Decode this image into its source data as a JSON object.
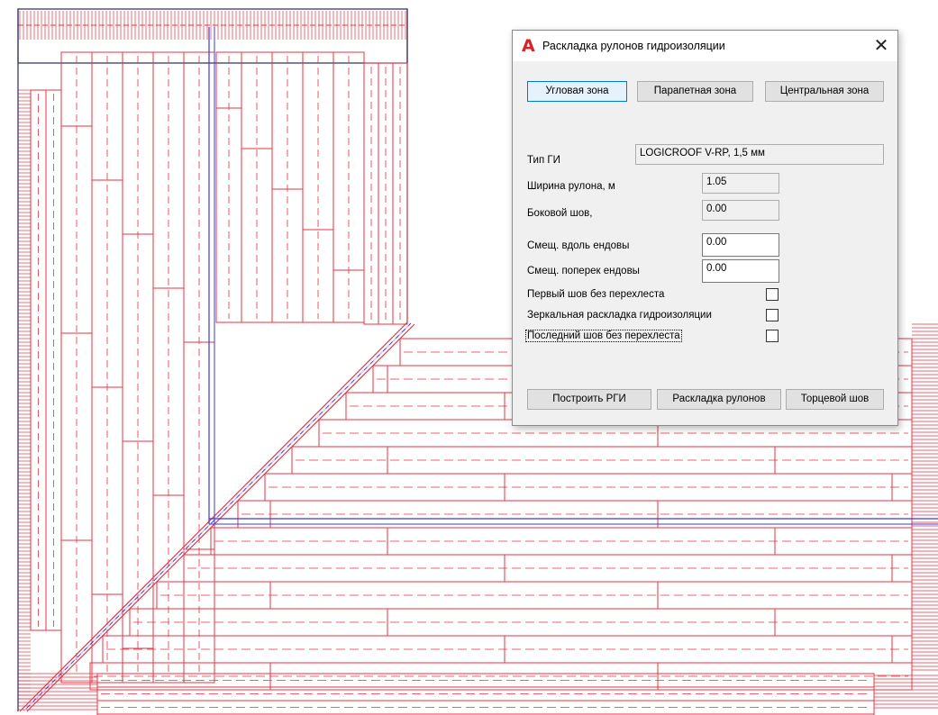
{
  "dialog": {
    "title": "Раскладка рулонов гидроизоляции",
    "app_icon_glyph": "A",
    "close_glyph": "✕",
    "zone_tabs": [
      {
        "label": "Угловая зона",
        "active": true
      },
      {
        "label": "Парапетная зона",
        "active": false
      },
      {
        "label": "Центральная зона",
        "active": false
      }
    ],
    "fields": {
      "type_label": "Тип ГИ",
      "type_value": "LOGICROOF V-RP, 1,5 мм",
      "roll_width_label": "Ширина рулона, м",
      "roll_width_value": "1.05",
      "side_seam_label": "Боковой шов,",
      "side_seam_value": "0.00",
      "offset_along_label": "Смещ. вдоль ендовы",
      "offset_along_value": "0.00",
      "offset_across_label": "Смещ. поперек ендовы",
      "offset_across_value": "0.00"
    },
    "checkboxes": [
      {
        "label": "Первый шов без перехлеста",
        "checked": false
      },
      {
        "label": "Зеркальная раскладка гидроизоляции",
        "checked": false
      },
      {
        "label": "Последний шов без перехлеста",
        "checked": false
      }
    ],
    "actions": {
      "build_label": "Построить РГИ",
      "layout_label": "Раскладка рулонов",
      "end_seam_label": "Торцевой шов"
    }
  },
  "colors": {
    "roll_outline": "#e8333f",
    "axis_line": "#3b3bd6",
    "frame": "#2a2a5a",
    "accent": "#0078d7",
    "app_icon": "#d8232a"
  }
}
